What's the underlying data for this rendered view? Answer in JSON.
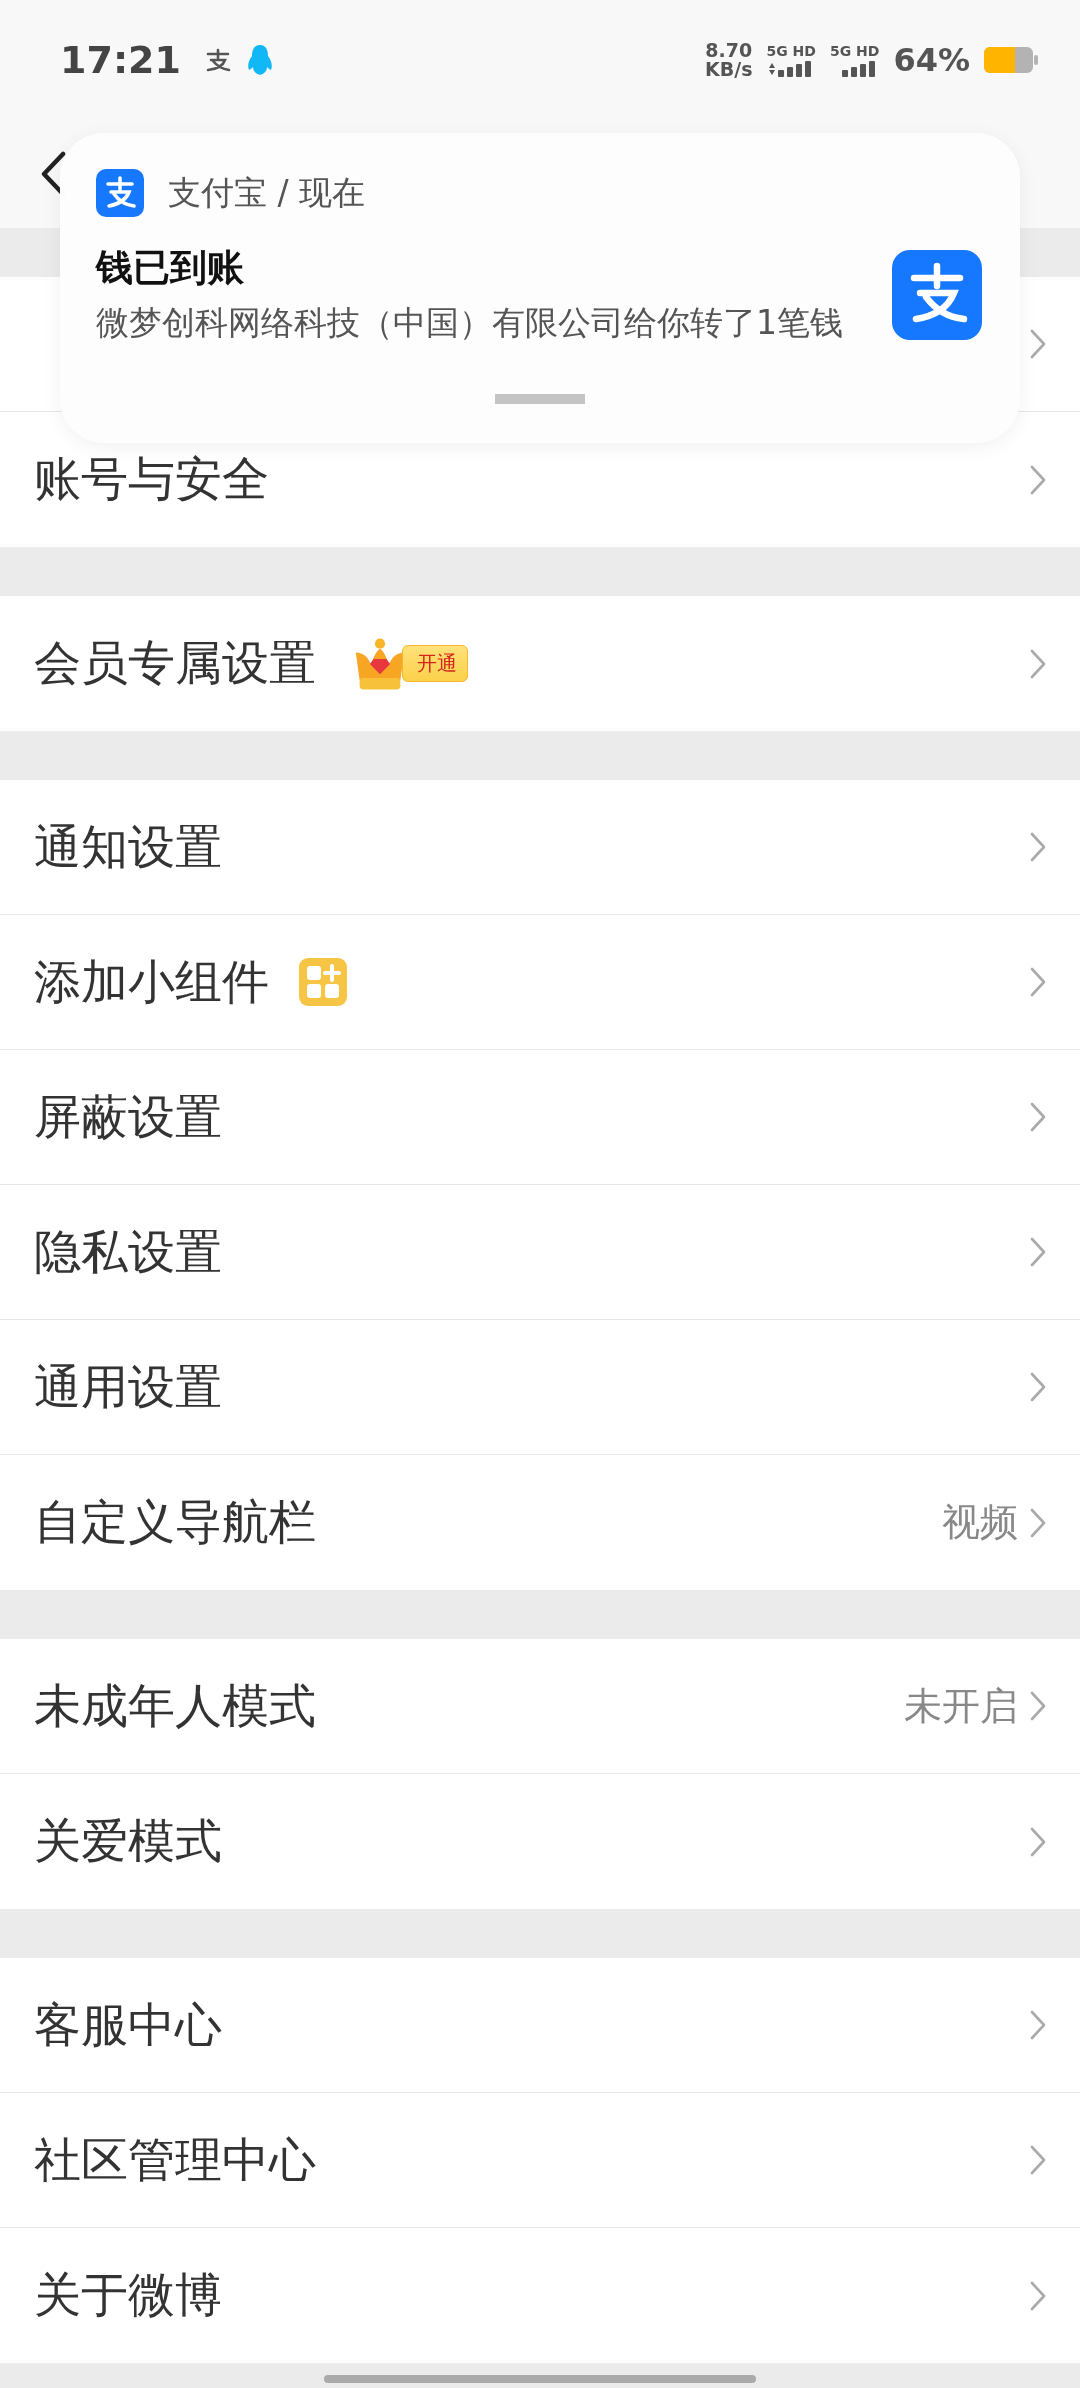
{
  "status_bar": {
    "time": "17:21",
    "speed_value": "8.70",
    "speed_unit": "KB/s",
    "sims": [
      "5G HD",
      "5G HD"
    ],
    "battery": "64%"
  },
  "notification": {
    "source": "支付宝 / 现在",
    "title": "钱已到账",
    "body": "微梦创科网络科技（中国）有限公司给你转了1笔钱"
  },
  "groups": [
    [
      {
        "kind": "plain"
      },
      {
        "kind": "plain",
        "title": "账号与安全"
      }
    ],
    [
      {
        "kind": "vip",
        "title": "会员专属设置",
        "badge": "开通"
      }
    ],
    [
      {
        "kind": "plain",
        "title": "通知设置"
      },
      {
        "kind": "widget",
        "title": "添加小组件"
      },
      {
        "kind": "plain",
        "title": "屏蔽设置"
      },
      {
        "kind": "plain",
        "title": "隐私设置"
      },
      {
        "kind": "plain",
        "title": "通用设置"
      },
      {
        "kind": "plain",
        "title": "自定义导航栏",
        "value": "视频"
      }
    ],
    [
      {
        "kind": "plain",
        "title": "未成年人模式",
        "value": "未开启"
      },
      {
        "kind": "plain",
        "title": "关爱模式"
      }
    ],
    [
      {
        "kind": "plain",
        "title": "客服中心"
      },
      {
        "kind": "plain",
        "title": "社区管理中心"
      },
      {
        "kind": "plain",
        "title": "关于微博"
      }
    ]
  ]
}
